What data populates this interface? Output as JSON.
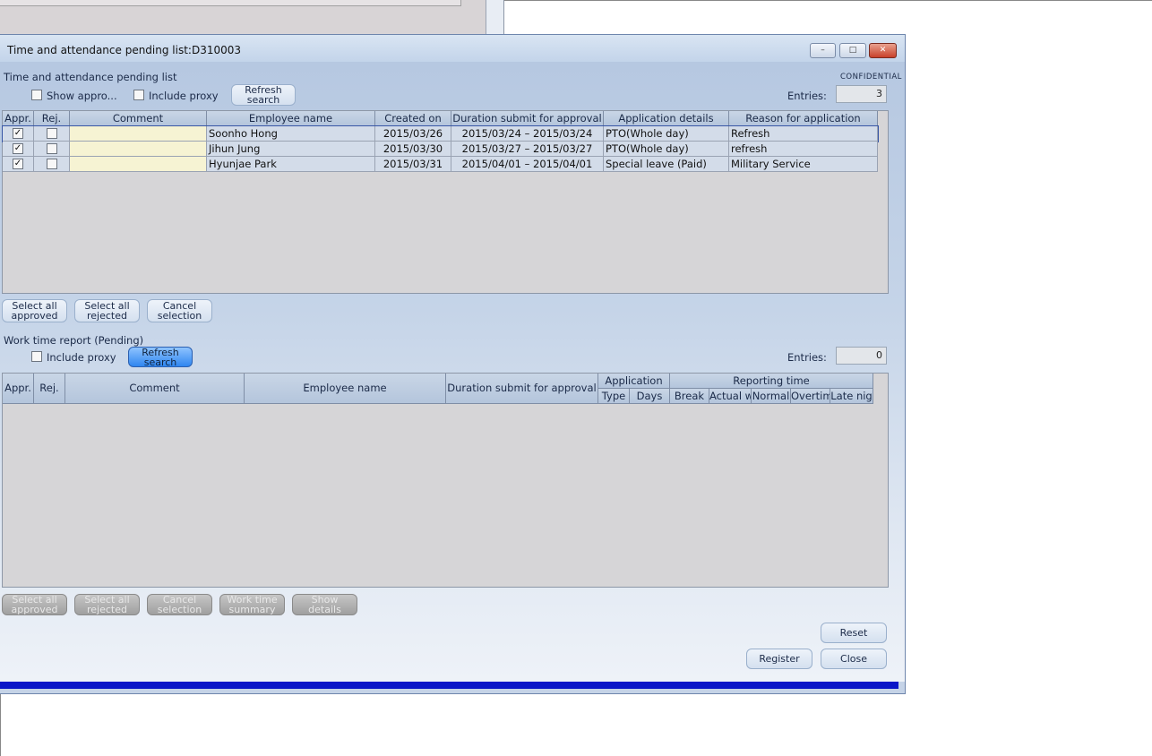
{
  "window": {
    "title": "Time and attendance pending list:D310003",
    "min_label": "–",
    "max_label": "□",
    "close_label": "✕"
  },
  "pending": {
    "section_title": "Time and attendance pending list",
    "confidential": "CONFIDENTIAL",
    "show_approved_label": "Show appro...",
    "include_proxy_label": "Include proxy",
    "refresh_label": "Refresh search",
    "entries_label": "Entries:",
    "entries_value": "3",
    "columns": [
      "Appr.",
      "Rej.",
      "Comment",
      "Employee name",
      "Created on",
      "Duration submit for approval",
      "Application details",
      "Reason for application"
    ],
    "rows": [
      {
        "appr": true,
        "rej": false,
        "comment": "",
        "employee": "Soonho Hong",
        "created": "2015/03/26",
        "duration": "2015/03/24 – 2015/03/24",
        "details": "PTO(Whole day)",
        "reason": "Refresh"
      },
      {
        "appr": true,
        "rej": false,
        "comment": "",
        "employee": "Jihun Jung",
        "created": "2015/03/30",
        "duration": "2015/03/27 – 2015/03/27",
        "details": "PTO(Whole day)",
        "reason": "refresh"
      },
      {
        "appr": true,
        "rej": false,
        "comment": "",
        "employee": "Hyunjae Park",
        "created": "2015/03/31",
        "duration": "2015/04/01 – 2015/04/01",
        "details": "Special leave (Paid)",
        "reason": "Military Service"
      }
    ],
    "select_all_approved": "Select all approved",
    "select_all_rejected": "Select all rejected",
    "cancel_selection": "Cancel selection"
  },
  "worktime": {
    "section_title": "Work time report (Pending)",
    "include_proxy_label": "Include proxy",
    "refresh_label": "Refresh search",
    "entries_label": "Entries:",
    "entries_value": "0",
    "columns": {
      "appr": "Appr.",
      "rej": "Rej.",
      "comment": "Comment",
      "employee": "Employee name",
      "duration": "Duration submit for approval",
      "application": "Application",
      "type": "Type",
      "days": "Days",
      "reporting": "Reporting time",
      "break": "Break",
      "actual": "Actual w",
      "normal": "Normal",
      "overtime": "Overtim",
      "latenight": "Late nig"
    },
    "select_all_approved": "Select all approved",
    "select_all_rejected": "Select all rejected",
    "cancel_selection": "Cancel selection",
    "work_time_summary": "Work time summary",
    "show_details": "Show details"
  },
  "footer": {
    "reset": "Reset",
    "register": "Register",
    "close": "Close"
  },
  "colors": {
    "accent": "#2f86f0",
    "statusbar": "#0a16c8",
    "comment_cell": "#f6f3d3"
  }
}
